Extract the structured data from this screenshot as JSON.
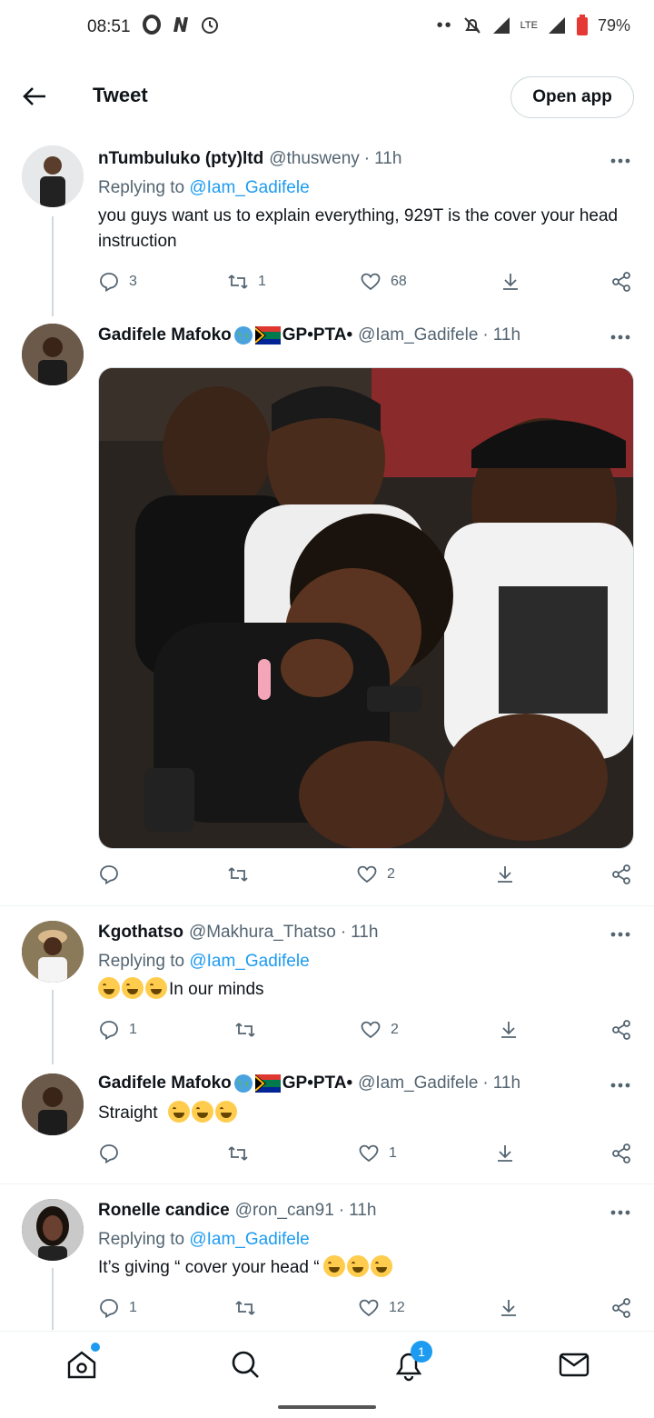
{
  "status_bar": {
    "time": "08:51",
    "battery": "79%",
    "network": "LTE"
  },
  "header": {
    "title": "Tweet",
    "open_app_label": "Open app"
  },
  "tweets": [
    {
      "name": "nTumbuluko (pty)ltd",
      "handle": "@thusweny",
      "time": "11h",
      "replying_prefix": "Replying to",
      "replying_to": "@Iam_Gadifele",
      "text": "you guys want us to explain everything, 929T is the cover your head instruction",
      "replies": "3",
      "retweets": "1",
      "likes": "68"
    },
    {
      "name": "Gadifele Mafoko",
      "name_suffix": "GP•PTA•",
      "handle": "@Iam_Gadifele",
      "time": "11h",
      "likes": "2"
    },
    {
      "name": "Kgothatso",
      "handle": "@Makhura_Thatso",
      "time": "11h",
      "replying_prefix": "Replying to",
      "replying_to": "@Iam_Gadifele",
      "text": "In our minds",
      "replies": "1",
      "likes": "2"
    },
    {
      "name": "Gadifele Mafoko",
      "name_suffix": "GP•PTA•",
      "handle": "@Iam_Gadifele",
      "time": "11h",
      "text": "Straight",
      "likes": "1"
    },
    {
      "name": "Ronelle candice",
      "handle": "@ron_can91",
      "time": "11h",
      "replying_prefix": "Replying to",
      "replying_to": "@Iam_Gadifele",
      "text": "It’s giving “ cover your head “",
      "replies": "1",
      "likes": "12"
    }
  ],
  "bottom_nav": {
    "notifications_badge": "1"
  },
  "colors": {
    "link": "#1d9bf0",
    "secondary_text": "#536471",
    "divider": "#eff3f4"
  }
}
